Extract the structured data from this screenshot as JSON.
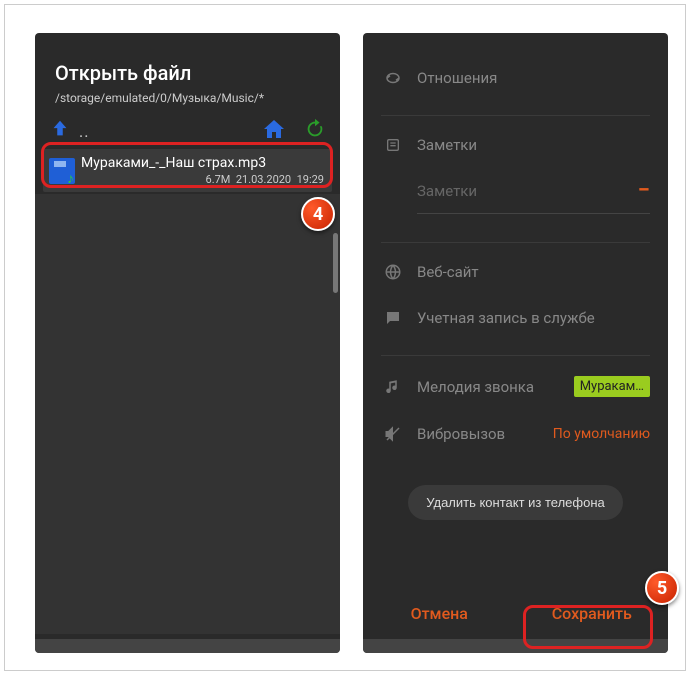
{
  "left": {
    "title": "Открыть файл",
    "path": "/storage/emulated/0/Музыка/Music/*",
    "dots": "..",
    "file": {
      "name": "Мураками_-_Наш страх.mp3",
      "size": "6.7M",
      "date": "21.03.2020",
      "time": "19:29"
    },
    "badge4": "4"
  },
  "right": {
    "rows": {
      "relations": "Отношения",
      "notes": "Заметки",
      "notes_input": "Заметки",
      "website": "Веб-сайт",
      "account": "Учетная запись в службе",
      "ringtone": "Мелодия звонка",
      "ringtone_value": "Муракам…",
      "vibration": "Вибровызов",
      "vibration_value": "По умолчанию"
    },
    "delete_btn": "Удалить контакт из телефона",
    "footer": {
      "cancel": "Отмена",
      "save": "Сохранить"
    },
    "badge5": "5"
  }
}
